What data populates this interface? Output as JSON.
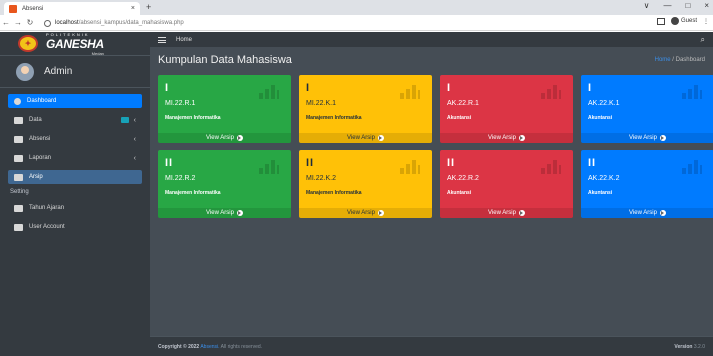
{
  "browser": {
    "tab_title": "Absensi",
    "tab_close": "×",
    "new_tab": "+",
    "url_host": "localhost",
    "url_path": "/absensi_kampus/data_mahasiswa.php",
    "profile_label": "Guest",
    "window_controls": [
      "∨",
      "—",
      "□",
      "×"
    ]
  },
  "sidebar": {
    "logo": {
      "top": "POLITEKNIK",
      "main": "GANESHA",
      "sub": "Medan"
    },
    "user_name": "Admin",
    "items": [
      {
        "label": "Dashboard",
        "icon": "palette-icon",
        "state": "active"
      },
      {
        "label": "Data",
        "icon": "folder-icon",
        "has_badge": true,
        "chevron": "‹"
      },
      {
        "label": "Absensi",
        "icon": "user-icon",
        "chevron": "‹"
      },
      {
        "label": "Laporan",
        "icon": "table-icon",
        "chevron": "‹"
      },
      {
        "label": "Arsip",
        "icon": "archive-icon",
        "state": "highlight"
      }
    ],
    "section_header": "Setting",
    "settings": [
      {
        "label": "Tahun Ajaran",
        "icon": "calendar-icon"
      },
      {
        "label": "User Account",
        "icon": "id-card-icon"
      }
    ]
  },
  "topnav": {
    "home": "Home",
    "search_icon": "search-icon"
  },
  "header": {
    "title": "Kumpulan Data Mahasiswa",
    "crumb_home": "Home",
    "crumb_sep": "/",
    "crumb_current": "Dashboard"
  },
  "cards": [
    {
      "num": "I",
      "code": "MI.22.R.1",
      "prodi": "Manajemen Informatika",
      "link": "View Arsip",
      "color": "#28a745"
    },
    {
      "num": "I",
      "code": "MI.22.K.1",
      "prodi": "Manajemen Informatika",
      "link": "View Arsip",
      "color": "#ffc107"
    },
    {
      "num": "I",
      "code": "AK.22.R.1",
      "prodi": "Akuntansi",
      "link": "View Arsip",
      "color": "#dc3545"
    },
    {
      "num": "I",
      "code": "AK.22.K.1",
      "prodi": "Akuntansi",
      "link": "View Arsip",
      "color": "#007bff"
    },
    {
      "num": "II",
      "code": "MI.22.R.2",
      "prodi": "Manajemen Informatika",
      "link": "View Arsip",
      "color": "#28a745"
    },
    {
      "num": "II",
      "code": "MI.22.K.2",
      "prodi": "Manajemen Informatika",
      "link": "View Arsip",
      "color": "#ffc107"
    },
    {
      "num": "II",
      "code": "AK.22.R.2",
      "prodi": "Akuntansi",
      "link": "View Arsip",
      "color": "#dc3545"
    },
    {
      "num": "II",
      "code": "AK.22.K.2",
      "prodi": "Akuntansi",
      "link": "View Arsip",
      "color": "#007bff"
    }
  ],
  "footer": {
    "copy_prefix": "Copyright © 2022",
    "brand": "Absensi.",
    "copy_suffix": "All rights reserved.",
    "version_label": "Version",
    "version_value": "3.2.0"
  }
}
